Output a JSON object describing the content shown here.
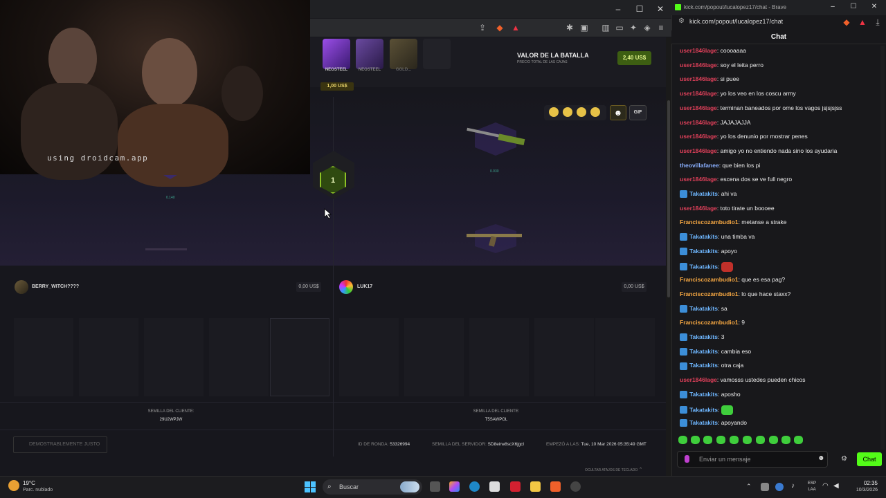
{
  "left_browser": {
    "window_controls": [
      "–",
      "☐",
      "✕"
    ]
  },
  "battle": {
    "boxes": [
      {
        "label": "NEOSTEEL",
        "color": "#7b3ad0"
      },
      {
        "label": "NEOSTEEL",
        "color": "#5b3490"
      },
      {
        "label": "GOLD...",
        "color": "#6e6040"
      },
      {
        "label": "",
        "color": "#25252c"
      }
    ],
    "box_price": "1,00 US$",
    "valor_title": "VALOR DE LA BATALLA",
    "valor_sub": "PRECIO TOTAL DE LAS CAJAS",
    "valor_value": "2,40 US$",
    "gif_label": "GIF",
    "round_number": "1",
    "left_item_value": "0.140",
    "right_item_value": "0.030",
    "players": [
      {
        "name": "BERRY_WITCH????",
        "value": "0,00 US$"
      },
      {
        "name": "LUK17",
        "value": "0,00 US$"
      }
    ],
    "seeds": [
      {
        "label": "SEMILLA DEL CLIENTE:",
        "value": "29U2WPJW"
      },
      {
        "label": "SEMILLA DEL CLIENTE:",
        "value": "T5SAWPOL"
      }
    ],
    "fair_label": "DEMOSTRABLEMENTE JUSTO",
    "round_id_label": "ID DE RONDA:",
    "round_id": "53326994",
    "server_seed_label": "SEMILLA DEL SERVIDOR:",
    "server_seed": "SD8eirw8scX6jgcl",
    "started_label": "EMPEZÓ A LAS:",
    "started": "Tue, 10 Mar 2026 05:35:49 GMT",
    "shortcuts_label": "OCULTAR ATAJOS DE TECLADO"
  },
  "webcam": {
    "overlay_text": "using droidcam.app"
  },
  "chat_window": {
    "title": "kick.com/popout/lucalopez17/chat - Brave",
    "url": "kick.com/popout/lucalopez17/chat",
    "header": "Chat",
    "input_placeholder": "Enviar un mensaje",
    "send_label": "Chat",
    "messages": [
      {
        "user": "user1846lage",
        "color": "#e0405a",
        "text": "coooaaaa",
        "bot": false
      },
      {
        "user": "user1846lage",
        "color": "#e0405a",
        "text": "soy el leita perro",
        "bot": false
      },
      {
        "user": "user1846lage",
        "color": "#e0405a",
        "text": "si puee",
        "bot": false
      },
      {
        "user": "user1846lage",
        "color": "#e0405a",
        "text": "yo los veo en los coscu army",
        "bot": false
      },
      {
        "user": "user1846lage",
        "color": "#e0405a",
        "text": "terminan baneados por ome los vagos jsjsjsjss",
        "bot": false
      },
      {
        "user": "user1846lage",
        "color": "#e0405a",
        "text": "JAJAJAJJA",
        "bot": false
      },
      {
        "user": "user1846lage",
        "color": "#e0405a",
        "text": "yo los denunio por mostrar penes",
        "bot": false
      },
      {
        "user": "user1846lage",
        "color": "#e0405a",
        "text": "amigo yo no entiendo nada sino los ayudaria",
        "bot": false
      },
      {
        "user": "theovillafanee",
        "color": "#8ab0ff",
        "text": "que bien los pi",
        "bot": false
      },
      {
        "user": "user1846lage",
        "color": "#e0405a",
        "text": "escena dos se ve full negro",
        "bot": false
      },
      {
        "user": "Takatakits",
        "color": "#6fb7ff",
        "text": "ahi va",
        "bot": true
      },
      {
        "user": "user1846lage",
        "color": "#e0405a",
        "text": "toto tirate un boooee",
        "bot": false
      },
      {
        "user": "Franciscozambudio1",
        "color": "#f5a742",
        "text": "metanse a strake",
        "bot": false
      },
      {
        "user": "Takatakits",
        "color": "#6fb7ff",
        "text": "una timba va",
        "bot": true
      },
      {
        "user": "Takatakits",
        "color": "#6fb7ff",
        "text": "apoyo",
        "bot": true
      },
      {
        "user": "Takatakits",
        "color": "#6fb7ff",
        "text": "",
        "bot": true,
        "emote": "#c0302a"
      },
      {
        "user": "Franciscozambudio1",
        "color": "#f5a742",
        "text": "que es esa pag?",
        "bot": false
      },
      {
        "user": "Franciscozambudio1",
        "color": "#f5a742",
        "text": "lo que hace staxx?",
        "bot": false
      },
      {
        "user": "Takatakits",
        "color": "#6fb7ff",
        "text": "sa",
        "bot": true
      },
      {
        "user": "Franciscozambudio1",
        "color": "#f5a742",
        "text": "9",
        "bot": false
      },
      {
        "user": "Takatakits",
        "color": "#6fb7ff",
        "text": "3",
        "bot": true
      },
      {
        "user": "Takatakits",
        "color": "#6fb7ff",
        "text": "cambia eso",
        "bot": true
      },
      {
        "user": "Takatakits",
        "color": "#6fb7ff",
        "text": "otra caja",
        "bot": true
      },
      {
        "user": "user1846lage",
        "color": "#e0405a",
        "text": "vamosss ustedes pueden chicos",
        "bot": false
      },
      {
        "user": "Takatakits",
        "color": "#6fb7ff",
        "text": "aposho",
        "bot": true
      },
      {
        "user": "Takatakits",
        "color": "#6fb7ff",
        "text": "",
        "bot": true,
        "emote": "#3fce3c"
      },
      {
        "user": "Takatakits",
        "color": "#6fb7ff",
        "text": "apoyando",
        "bot": true
      }
    ]
  },
  "taskbar": {
    "temperature": "19°C",
    "weather": "Parc. nublado",
    "search_placeholder": "Buscar",
    "language": "ESP",
    "language_sub": "LAA",
    "time": "02:35",
    "date": "10/3/2026"
  }
}
